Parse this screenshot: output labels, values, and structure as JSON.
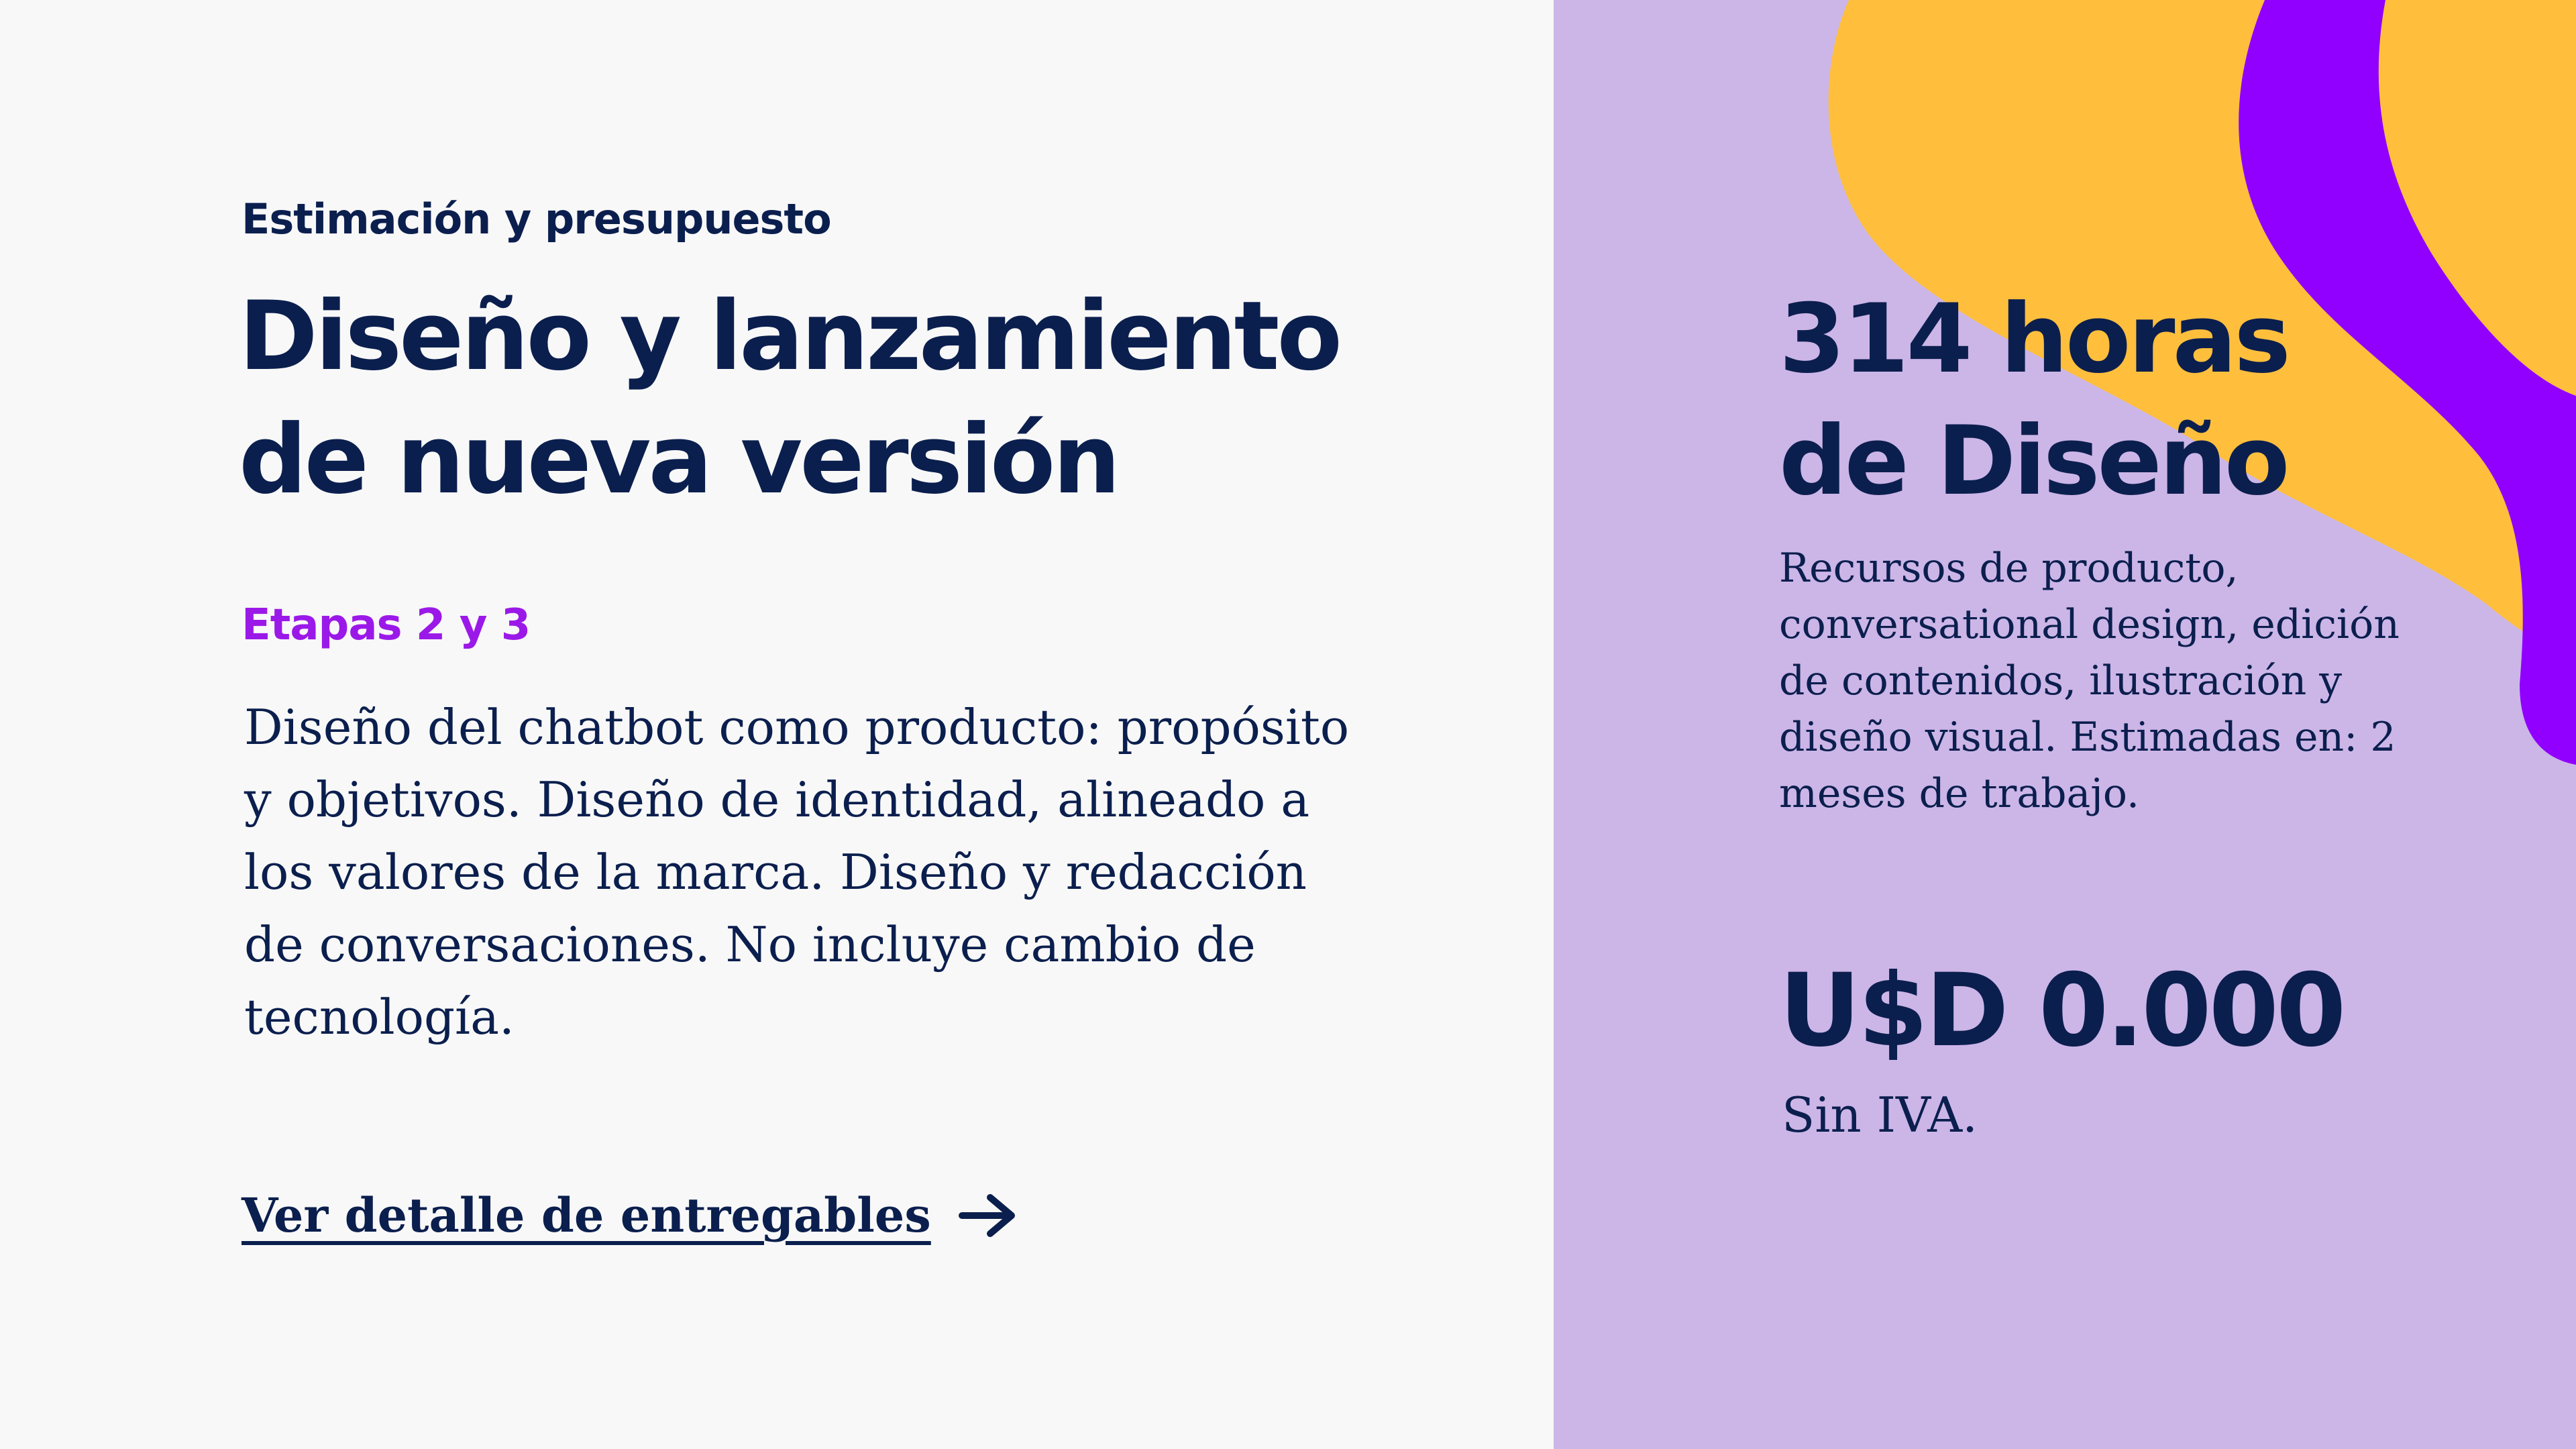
{
  "colors": {
    "navy": "#0b1f4e",
    "purple_accent": "#9b19e8",
    "lavender_panel": "#ccb6e7",
    "yellow_blob": "#ffbf3d",
    "violet_ribbon": "#9100fe",
    "left_background": "#f8f8f8"
  },
  "left": {
    "eyebrow": "Estimación y presupuesto",
    "headline_line1": "Diseño y lanzamiento",
    "headline_line2": "de nueva versión",
    "stage_label": "Etapas 2 y 3",
    "body": "Diseño del chatbot como producto: propósito y objetivos. Diseño de identidad, alineado a los valores de la marca. Diseño y redacción de conversaciones. No incluye cambio de tecnología.",
    "cta_label": "Ver detalle de entregables",
    "cta_icon": "arrow-right-icon"
  },
  "right": {
    "hours_line1": "314 horas",
    "hours_line2": "de Diseño",
    "hours_description": "Recursos de producto, conversational design, edición de contenidos, ilustración y diseño visual. Estimadas en: 2 meses de trabajo.",
    "price": "U$D 0.000",
    "price_note": "Sin IVA."
  }
}
